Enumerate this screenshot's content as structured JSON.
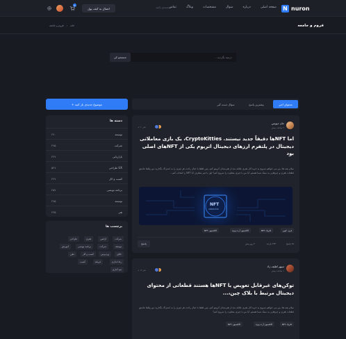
{
  "header": {
    "logo_letter": "N",
    "logo_text": "nuron",
    "nav": [
      "صفحه اصلی",
      "درباره",
      "سوال",
      "مشخصات",
      "وبلاگ",
      "تماس"
    ],
    "search_placeholder": "جستجو بکنید",
    "connect_label": "اتصال به کیف پول",
    "cart_count": "0"
  },
  "page": {
    "title": "فروم و جامعه",
    "breadcrumb": [
      "خانه",
      "فروم و جامعه"
    ],
    "search_placeholder": "درمیه بگردید...",
    "search_button": "جستجو کن"
  },
  "sidebar": {
    "new_topic": "موضوع جدیدی باز کنید +",
    "categories_title": "دسته ها",
    "categories": [
      {
        "name": "توسعه",
        "count": "۲۷۰"
      },
      {
        "name": "شرکت",
        "count": "۲۷۵"
      },
      {
        "name": "بازاریابی",
        "count": "۲۲۷"
      },
      {
        "name": "UX طراحی",
        "count": "۵۲۷"
      },
      {
        "name": "کسب و کار",
        "count": "۲۲۷"
      },
      {
        "name": "برنامه نویسی",
        "count": "۲۵۷"
      },
      {
        "name": "توسعه",
        "count": "۲۷۵"
      },
      {
        "name": "هنر",
        "count": "۲۳۵"
      }
    ],
    "tags_title": "برچسب ها",
    "tags": [
      "شرکت",
      "اژانس",
      "هنری",
      "طراحی",
      "توسعه",
      "شرکت",
      "برنامه نویسی",
      "آموزش",
      "خلاق",
      "وردپرس",
      "کسب و کار",
      "ذهن",
      "راه اندازی",
      "فریلند",
      "کسب",
      "تیم آماری"
    ]
  },
  "tabs": [
    "محتوای اخیر",
    "بیشترین پاسخ",
    "سؤال دست گیر"
  ],
  "posts": [
    {
      "author": "جان دیویس",
      "time": "۲ ساعت پیش",
      "title": "اما NFTها دقیقاً جدید نیستند. CryptoKitties، یک بازی معاملاتی دیجیتال در پلتفرم ارزهای دیجیتال اتریوم یکی از NFTهای اصلی بود",
      "excerpt": "سلام بچه ها، من می خواهم شروع به خرید آثار هنری علاقه مند از هنرمندان کریپتو کنم. پس لطفا با خیال راحت هر چیزی را به اشتراک بگذارید من واقعا عاشق قطعات هنری و چیزهایی به سبک شما هستم. آیا من با چیزی متفاوت را شروع کنم؟ اول با غیر متعارف آیا NFT را انتخاب کنم...",
      "nft_label": "NFT",
      "nft_caption": "GENERATOR",
      "others_label": "+ ۲۰ نفر",
      "tags": [
        "قرن، کوین",
        "فلزیک NFT",
        "کلکسیون آرت ویژه",
        "کلکسیون NFT"
      ],
      "stats": [
        "۲۵ پاسخ",
        "۲۴۳ بازدید",
        "۳ روز پیش"
      ],
      "reply": "پاسخ"
    },
    {
      "author": "سپهر لطیف زاد",
      "time": "۱ ساعت پیش",
      "title": "توکن‌های غیرقابل تعویض یا NFTها هستند قطعاتی از محتوای دیجیتال مرتبط با بلاک چین،...",
      "excerpt": "سلام بچه ها، من می خواهم شروع به خرید آثار هنری علاقه مند از هنرمندان کریپتو کنم. پس لطفا با خیال راحت هر چیزی را به اشتراک بگذارید من واقعا عاشق قطعات هنری و چیزهایی به سبک شما هستم. آیا من با چیزی متفاوت را شروع کنم؟",
      "others_label": "+ ۱۲ نفر",
      "tags": [
        "فلزیک NFT",
        "کلکسیون آرت ویژه",
        "کلکسیون NFT"
      ]
    }
  ],
  "colors": {
    "accent": "#2f7cf6",
    "bg": "#191b22",
    "card": "#20232b"
  }
}
